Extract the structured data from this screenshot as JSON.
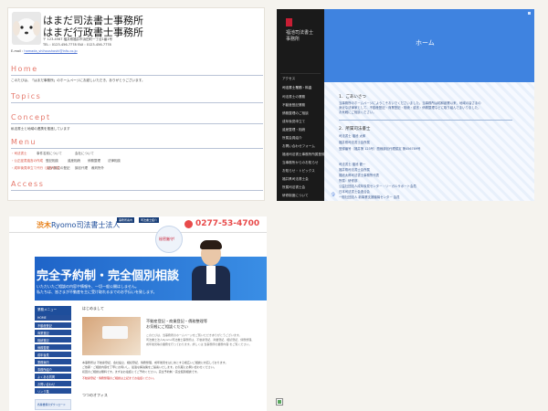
{
  "tile1": {
    "header": {
      "line1": "はまだ司法書士事務所",
      "line2": "はまだ行政書士事務所",
      "address": "〒 123-4567  福井県福井市浜田町一丁目1番1号",
      "tel": "TEL : 0123-456-7778    FAX : 0123-456-7778",
      "email_label": "E-mail : ",
      "email_value": "hamada_shihoushoshi@info.co.jp"
    },
    "sections": {
      "home": "Home",
      "home_text": "このたびは、「はまだ事務所」のホームページにお越しいただき、ありがとうございます。",
      "topics": "Topics",
      "concept": "Concept",
      "concept_text": "私法書士と地域の連携を推進しています",
      "menu": "Menu",
      "access": "Access"
    },
    "menu_rows": [
      [
        "・司法書士",
        "事件名前について",
        "会社について",
        ""
      ],
      [
        "・公正証書遺言の作成",
        "登記相談",
        "遺産相続",
        "債務整理",
        "法律相談"
      ],
      [
        "・成年後見申立て代行（遺言作成）",
        "法人設立の登記",
        "訴訟代理",
        "裁判所外"
      ]
    ]
  },
  "tile2": {
    "firm_line1": "福池司法書士",
    "firm_line2": "事務所",
    "hero_title": "ホーム",
    "nav": [
      "アクセス",
      "司法書士業務・料金",
      "司法書士の業務",
      "不動産登記業務",
      "債務整理のご相談",
      "成年後見申立て",
      "遺産整理・相続",
      "所属会員紹介",
      "お問い合わせフォーム",
      "福池司法書士事務所所属登録状況",
      "当事務所からのお知らせ",
      "お知らせ・トピックス",
      "福井県司法書士会",
      "所属司法書士会",
      "研修制度について"
    ],
    "page_number": "9",
    "content": {
      "greeting_head": "1．ごあいさつ",
      "greeting_p1": "当事務所のホームページにようこそおいでくださいました。当事務所は昭和創業以来、地域の皆さまの",
      "greeting_p2": "身近な法律家として、不動産登記・商業登記・相続・遺言・債務整理などに取り組んでまいりました。",
      "greeting_p3": "お気軽にご相談ください。",
      "section2": "2．所属司法書士",
      "member1_name": "司法書士  福池 太郎",
      "member1_role": "福井県司法書士会所属",
      "member1_reg": "登録番号（福井第 123号）簡裁訴訟代理認定 第456789号",
      "member2_name": "司法書士  福池 健一",
      "member2_role": "福井県司法書士会所属",
      "member2_extra1": "福池太郎司法書士事務所代表",
      "member2_extra2": "所属：研修部",
      "member2_extra3": "公益社団法人成年後見センター・リーガルサポート会員",
      "member2_extra4": "日本司法書士会連合会",
      "member2_extra5": "一般社団法人 新事業支援機構センター 会員"
    }
  },
  "tile3": {
    "top_buttons": [
      "事務所案内",
      "司法書士紹介",
      "料金表"
    ],
    "brand_logo": "渋木",
    "brand_name": "Ryomo司法書士法人",
    "phone": "0277-53-4700",
    "bubble_text": "秘密厳守!",
    "headline": "完全予約制・完全個別相談",
    "subhead1": "いただいたご相談の内容や情報を、一切一般公開はしません。",
    "subhead2": "私たちは、皆さまが不動産を主に受け取れるまでのお手伝いを致します。",
    "menu_header": "業務メニュー",
    "side_menu": [
      "HOME",
      "不動産登記",
      "商業登記",
      "相続登記",
      "債務整理",
      "成年後見",
      "業務案内",
      "事務所紹介",
      "よくある質問",
      "お問い合わせ",
      "リンク集"
    ],
    "sidebar_banner": "各種書類のダウンロード",
    "welcome": "はじめまして",
    "service_line1": "不動産登記・商業登記・債務整理等",
    "service_line2": "お気軽にご相談ください",
    "text_lines": [
      "このたびは、当事務所のホームページをご覧いただきありがとうございます。",
      "司法書士法人Ryomo司法書士事務所は、不動産登記、商業登記、相続登記、債務整理、",
      "成年後見等の業務を行っております。詳しくは 当事務所の業務内容 をご覧ください。"
    ],
    "paras": [
      "本事務所は 不動産登記、会社設立、相続登記、債務整理、成年後見をはじめとする幅広いご相談に対応しております。",
      "ご依頼・ご相談内容を丁寧にお伺いし、最適な解決策をご提案いたします。お気軽にお問い合わせください。",
      "初回のご相談は無料です。まずはお電話にてご予約ください。完全予約制・完全個別相談です。"
    ],
    "red_note": "不動産登記・債務整理のご相談は上記までお電話ください。",
    "offices": "つつのオフィス"
  },
  "colors": {
    "accent_red": "#e5776a",
    "nav_dark": "#1a1a1a",
    "hero_blue": "#3f83e0",
    "brand_blue": "#1e4e9b"
  }
}
